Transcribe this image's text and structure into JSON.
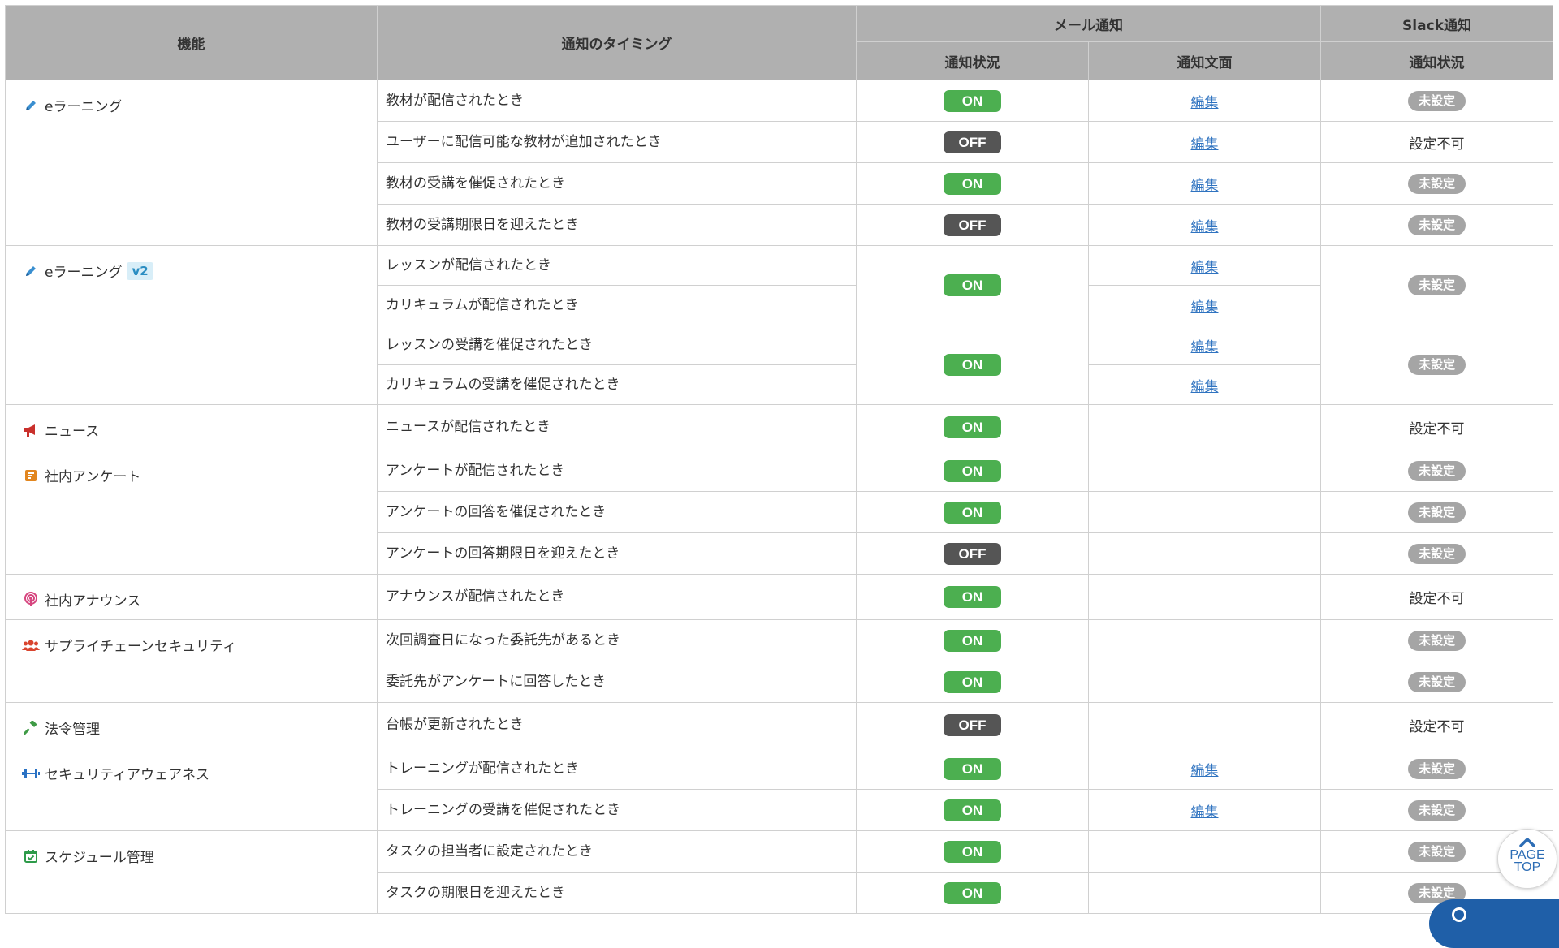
{
  "header": {
    "feature": "機能",
    "timing": "通知のタイミング",
    "mail": "メール通知",
    "slack": "Slack通知",
    "mail_status": "通知状況",
    "mail_text": "通知文面",
    "slack_status": "通知状況"
  },
  "labels": {
    "on": "ON",
    "off": "OFF",
    "edit": "編集",
    "unset": "未設定",
    "na": "設定不可"
  },
  "features": {
    "elearning": "eラーニング",
    "elearning_v2": "eラーニング",
    "v2_badge": "v2",
    "news": "ニュース",
    "survey": "社内アンケート",
    "announce": "社内アナウンス",
    "supply": "サプライチェーンセキュリティ",
    "law": "法令管理",
    "awareness": "セキュリティアウェアネス",
    "schedule": "スケジュール管理"
  },
  "rows": [
    {
      "timing": "教材が配信されたとき",
      "mail": "ON",
      "text": "編集",
      "slack": "未設定"
    },
    {
      "timing": "ユーザーに配信可能な教材が追加されたとき",
      "mail": "OFF",
      "text": "編集",
      "slack": "設定不可"
    },
    {
      "timing": "教材の受講を催促されたとき",
      "mail": "ON",
      "text": "編集",
      "slack": "未設定"
    },
    {
      "timing": "教材の受講期限日を迎えたとき",
      "mail": "OFF",
      "text": "編集",
      "slack": "未設定"
    },
    {
      "timing": "レッスンが配信されたとき",
      "mail": "ON",
      "text": "編集",
      "slack": "未設定"
    },
    {
      "timing": "カリキュラムが配信されたとき",
      "mail": "",
      "text": "編集",
      "slack": ""
    },
    {
      "timing": "レッスンの受講を催促されたとき",
      "mail": "ON",
      "text": "編集",
      "slack": "未設定"
    },
    {
      "timing": "カリキュラムの受講を催促されたとき",
      "mail": "",
      "text": "編集",
      "slack": ""
    },
    {
      "timing": "ニュースが配信されたとき",
      "mail": "ON",
      "text": "",
      "slack": "設定不可"
    },
    {
      "timing": "アンケートが配信されたとき",
      "mail": "ON",
      "text": "",
      "slack": "未設定"
    },
    {
      "timing": "アンケートの回答を催促されたとき",
      "mail": "ON",
      "text": "",
      "slack": "未設定"
    },
    {
      "timing": "アンケートの回答期限日を迎えたとき",
      "mail": "OFF",
      "text": "",
      "slack": "未設定"
    },
    {
      "timing": "アナウンスが配信されたとき",
      "mail": "ON",
      "text": "",
      "slack": "設定不可"
    },
    {
      "timing": "次回調査日になった委託先があるとき",
      "mail": "ON",
      "text": "",
      "slack": "未設定"
    },
    {
      "timing": "委託先がアンケートに回答したとき",
      "mail": "ON",
      "text": "",
      "slack": "未設定"
    },
    {
      "timing": "台帳が更新されたとき",
      "mail": "OFF",
      "text": "",
      "slack": "設定不可"
    },
    {
      "timing": "トレーニングが配信されたとき",
      "mail": "ON",
      "text": "編集",
      "slack": "未設定"
    },
    {
      "timing": "トレーニングの受講を催促されたとき",
      "mail": "ON",
      "text": "編集",
      "slack": "未設定"
    },
    {
      "timing": "タスクの担当者に設定されたとき",
      "mail": "ON",
      "text": "",
      "slack": "未設定"
    },
    {
      "timing": "タスクの期限日を迎えたとき",
      "mail": "ON",
      "text": "",
      "slack": "未設定"
    }
  ],
  "page_top": {
    "line1": "PAGE",
    "line2": "TOP"
  },
  "colors": {
    "on": "#4caf50",
    "off": "#555555",
    "unset": "#a5a5a5",
    "header": "#b0b0b0",
    "link": "#2f73c0",
    "v2_bg": "#d8eef8",
    "v2_text": "#2a8dc2"
  },
  "icons": {
    "elearning": "pencil-icon",
    "elearning_v2": "pencil-icon",
    "news": "megaphone-icon",
    "survey": "survey-icon",
    "announce": "podcast-icon",
    "supply": "users-icon",
    "law": "gavel-icon",
    "awareness": "dumbbell-icon",
    "schedule": "calendar-check-icon",
    "page_top": "chevron-up-icon",
    "help": "help-icon"
  }
}
